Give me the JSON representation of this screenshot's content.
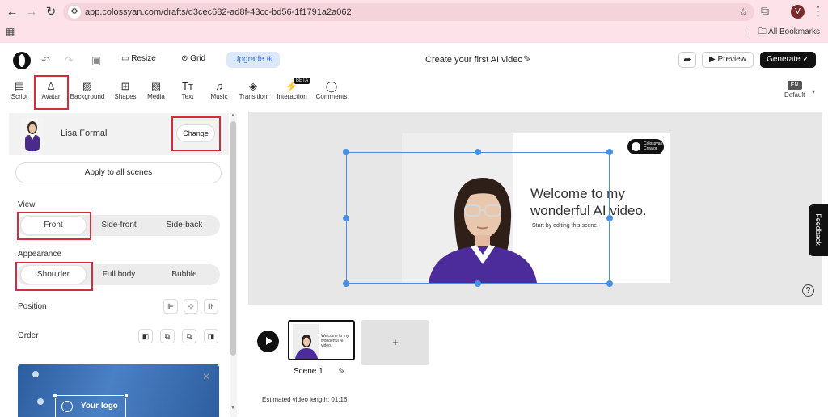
{
  "browser": {
    "url": "app.colossyan.com/drafts/d3cec682-ad8f-43cc-bd56-1f1791a2a062",
    "profile_initial": "V",
    "bookmarks_label": "All Bookmarks"
  },
  "header": {
    "resize_label": "Resize",
    "grid_label": "Grid",
    "upgrade_label": "Upgrade",
    "title": "Create your first AI video",
    "preview_label": "Preview",
    "generate_label": "Generate"
  },
  "toolbar": {
    "items": [
      "Script",
      "Avatar",
      "Background",
      "Shapes",
      "Media",
      "Text",
      "Music",
      "Transition",
      "Interaction",
      "Comments"
    ],
    "beta_badge": "BETA",
    "language_code": "EN",
    "language_label": "Default"
  },
  "panel": {
    "avatar_name": "Lisa Formal",
    "change_label": "Change",
    "apply_label": "Apply to all scenes",
    "view_label": "View",
    "view_options": [
      "Front",
      "Side-front",
      "Side-back"
    ],
    "appearance_label": "Appearance",
    "appearance_options": [
      "Shoulder",
      "Full body",
      "Bubble"
    ],
    "position_label": "Position",
    "order_label": "Order",
    "logo_text": "Your logo"
  },
  "slide": {
    "headline_1": "Welcome to my",
    "headline_2": "wonderful AI video.",
    "subtitle": "Start by editing this scene.",
    "logo_1": "Colossyan",
    "logo_2": "Creator"
  },
  "timeline": {
    "scene_name": "Scene 1",
    "thumb_text_1": "Welcome to my",
    "thumb_text_2": "wonderful AI video.",
    "add_label": "+",
    "estimated_length": "Estimated video length: 01:16"
  },
  "feedback_label": "Feedback",
  "help_label": "?",
  "colors": {
    "highlight": "#d52b3a",
    "selection": "#4a90e2",
    "upgrade": "#3a6fd8"
  }
}
